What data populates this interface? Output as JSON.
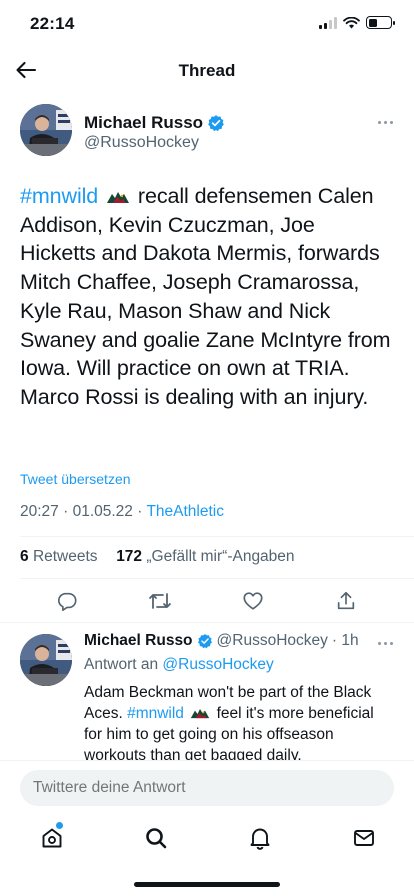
{
  "status_bar": {
    "time": "22:14"
  },
  "header": {
    "title": "Thread"
  },
  "main_tweet": {
    "author_name": "Michael Russo",
    "handle": "@RussoHockey",
    "hashtag": "#mnwild",
    "text": "recall defensemen Calen Addison, Kevin Czuczman, Joe Hicketts and Dakota Mermis, forwards Mitch Chaffee, Joseph Cramarossa, Kyle Rau, Mason Shaw and Nick Swaney and goalie Zane McIntyre from Iowa. Will practice on own at TRIA. Marco Rossi is dealing with an injury.",
    "translate_label": "Tweet übersetzen",
    "time": "20:27",
    "date": "01.05.22",
    "source": "TheAthletic",
    "retweets_count": "6",
    "retweets_label": "Retweets",
    "likes_count": "172",
    "likes_label": "„Gefällt mir“-Angaben"
  },
  "reply_tweet": {
    "author_name": "Michael Russo",
    "handle": "@RussoHockey",
    "age": "· 1h",
    "reply_to_prefix": "Antwort an",
    "reply_to_handle": "@RussoHockey",
    "text_before": "Adam Beckman won't be part of the Black Aces.",
    "hashtag": "#mnwild",
    "text_after": "feel it's more beneficial for him to get going on his offseason workouts than get bagged daily."
  },
  "compose": {
    "placeholder": "Twittere deine Antwort"
  },
  "icons": {
    "back": "arrow-left-icon",
    "verified": "verified-badge-icon",
    "more": "more-horizontal-icon",
    "reply": "reply-icon",
    "retweet": "retweet-icon",
    "like": "heart-icon",
    "share": "share-icon",
    "home": "home-icon",
    "search": "search-icon",
    "notifications": "bell-icon",
    "messages": "mail-icon"
  },
  "colors": {
    "accent": "#1d9bf0",
    "text": "#0f1419",
    "secondary_text": "#536471",
    "divider": "#eff3f4"
  }
}
